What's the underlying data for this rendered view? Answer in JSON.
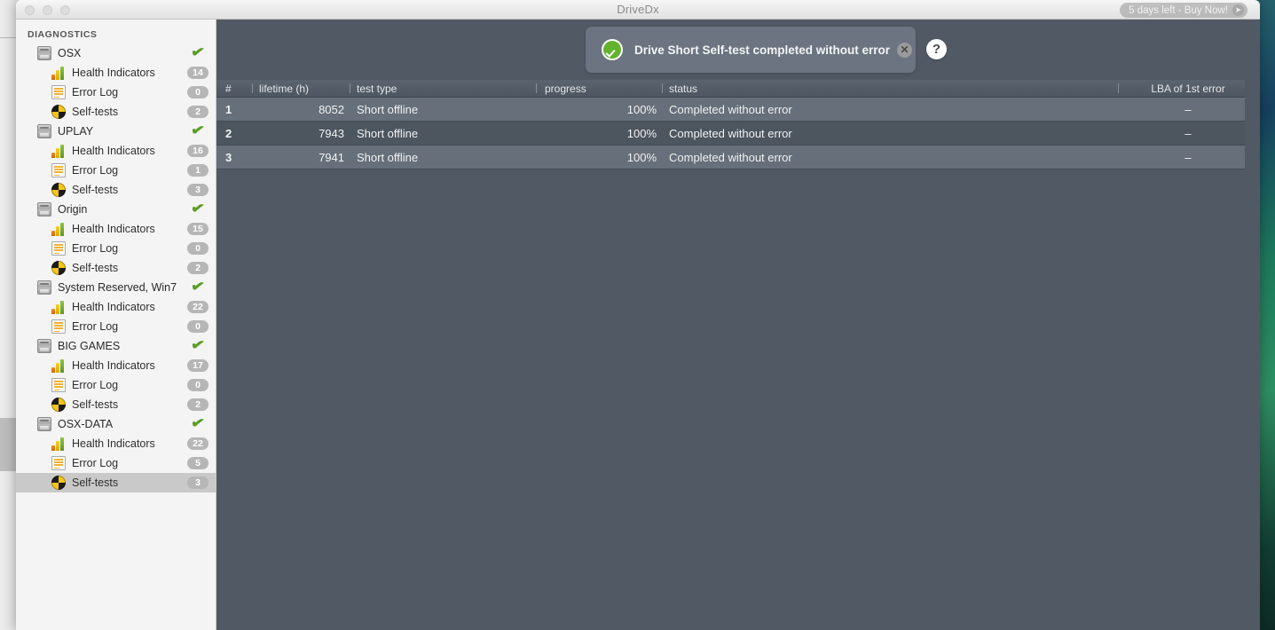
{
  "window": {
    "title": "DriveDx",
    "traffic_lights": [
      "close",
      "minimize",
      "maximize"
    ],
    "buy_now": {
      "label": "5 days left - Buy Now!",
      "arrow_icon": "arrow-right-icon"
    }
  },
  "sidebar": {
    "header": "DIAGNOSTICS",
    "drives": [
      {
        "name": "OSX",
        "icon": "hdd-icon",
        "status_icon": "green-check-icon",
        "children": [
          {
            "label": "Health Indicators",
            "icon": "bar-chart-icon",
            "count": "14"
          },
          {
            "label": "Error Log",
            "icon": "document-icon",
            "count": "0"
          },
          {
            "label": "Self-tests",
            "icon": "pie-chart-icon",
            "count": "2"
          }
        ]
      },
      {
        "name": "UPLAY",
        "icon": "hdd-icon",
        "status_icon": "green-check-icon",
        "children": [
          {
            "label": "Health Indicators",
            "icon": "bar-chart-icon",
            "count": "16"
          },
          {
            "label": "Error Log",
            "icon": "document-icon",
            "count": "1"
          },
          {
            "label": "Self-tests",
            "icon": "pie-chart-icon",
            "count": "3"
          }
        ]
      },
      {
        "name": "Origin",
        "icon": "hdd-icon",
        "status_icon": "green-check-icon",
        "children": [
          {
            "label": "Health Indicators",
            "icon": "bar-chart-icon",
            "count": "15"
          },
          {
            "label": "Error Log",
            "icon": "document-icon",
            "count": "0"
          },
          {
            "label": "Self-tests",
            "icon": "pie-chart-icon",
            "count": "2"
          }
        ]
      },
      {
        "name": "System Reserved, Win7",
        "icon": "hdd-icon",
        "status_icon": "green-check-icon",
        "children": [
          {
            "label": "Health Indicators",
            "icon": "bar-chart-icon",
            "count": "22"
          },
          {
            "label": "Error Log",
            "icon": "document-icon",
            "count": "0"
          }
        ]
      },
      {
        "name": "BIG GAMES",
        "icon": "hdd-icon",
        "status_icon": "green-check-icon",
        "children": [
          {
            "label": "Health Indicators",
            "icon": "bar-chart-icon",
            "count": "17"
          },
          {
            "label": "Error Log",
            "icon": "document-icon",
            "count": "0"
          },
          {
            "label": "Self-tests",
            "icon": "pie-chart-icon",
            "count": "2"
          }
        ]
      },
      {
        "name": "OSX-DATA",
        "icon": "hdd-icon",
        "status_icon": "green-check-icon",
        "children": [
          {
            "label": "Health Indicators",
            "icon": "bar-chart-icon",
            "count": "22",
            "selected": false
          },
          {
            "label": "Error Log",
            "icon": "document-icon",
            "count": "5",
            "selected": false
          },
          {
            "label": "Self-tests",
            "icon": "pie-chart-icon",
            "count": "3",
            "selected": true
          }
        ]
      }
    ]
  },
  "banner": {
    "icon": "green-check-circle-icon",
    "message": "Drive Short Self-test completed without error",
    "close_icon": "close-icon",
    "close_label": "✕"
  },
  "help_button": {
    "icon": "question-mark-icon",
    "label": "?"
  },
  "table": {
    "columns": [
      {
        "key": "num",
        "label": "#"
      },
      {
        "key": "life",
        "label": "lifetime (h)"
      },
      {
        "key": "type",
        "label": "test type"
      },
      {
        "key": "prog",
        "label": "progress"
      },
      {
        "key": "stat",
        "label": "status"
      },
      {
        "key": "lba",
        "label": "LBA of 1st error"
      }
    ],
    "rows": [
      {
        "num": "1",
        "life": "8052",
        "type": "Short offline",
        "prog": "100%",
        "stat": "Completed without error",
        "lba": "–"
      },
      {
        "num": "2",
        "life": "7943",
        "type": "Short offline",
        "prog": "100%",
        "stat": "Completed without error",
        "lba": "–"
      },
      {
        "num": "3",
        "life": "7941",
        "type": "Short offline",
        "prog": "100%",
        "stat": "Completed without error",
        "lba": "–"
      }
    ]
  },
  "colors": {
    "content_bg": "#515a64",
    "row_odd": "#676f7a",
    "row_even": "#4d555f",
    "header_bg": "#545d68",
    "sidebar_bg": "#f4f4f4",
    "selection": "#c9c9c9",
    "accent_green": "#5a9e25",
    "badge": "#b6b6b6"
  }
}
